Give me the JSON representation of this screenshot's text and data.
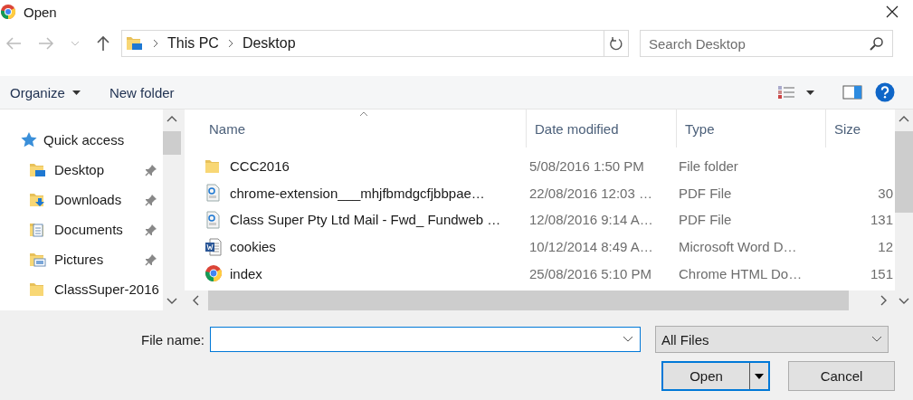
{
  "window": {
    "title": "Open"
  },
  "address": {
    "path": [
      "This PC",
      "Desktop"
    ]
  },
  "search": {
    "placeholder": "Search Desktop"
  },
  "toolbar": {
    "organize": "Organize",
    "new_folder": "New folder"
  },
  "sidebar": {
    "items": [
      {
        "label": "Quick access",
        "kind": "star",
        "pinned": false,
        "indented": false
      },
      {
        "label": "Desktop",
        "kind": "desktop",
        "pinned": true,
        "indented": true
      },
      {
        "label": "Downloads",
        "kind": "downloads",
        "pinned": true,
        "indented": true
      },
      {
        "label": "Documents",
        "kind": "documents",
        "pinned": true,
        "indented": true
      },
      {
        "label": "Pictures",
        "kind": "pictures",
        "pinned": true,
        "indented": true
      },
      {
        "label": "ClassSuper-2016",
        "kind": "folder",
        "pinned": false,
        "indented": true
      }
    ]
  },
  "table": {
    "columns": [
      {
        "label": "Name",
        "sorted": true
      },
      {
        "label": "Date modified",
        "sorted": false
      },
      {
        "label": "Type",
        "sorted": false
      },
      {
        "label": "Size",
        "sorted": false
      }
    ],
    "rows": [
      {
        "kind": "folder",
        "name": "CCC2016",
        "date": "5/08/2016 1:50 PM",
        "type": "File folder"
      },
      {
        "kind": "pdf",
        "name": "chrome-extension___mhjfbmdgcfjbbpae…",
        "date": "22/08/2016 12:03 …",
        "type": "PDF File",
        "size": "30"
      },
      {
        "kind": "pdf",
        "name": "Class Super Pty Ltd Mail - Fwd_ Fundweb …",
        "date": "12/08/2016 9:14 A…",
        "type": "PDF File",
        "size": "131"
      },
      {
        "kind": "word",
        "name": "cookies",
        "date": "10/12/2014 8:49 A…",
        "type": "Microsoft Word D…",
        "size": "12"
      },
      {
        "kind": "chrome",
        "name": "index",
        "date": "25/08/2016 5:10 PM",
        "type": "Chrome HTML Do…",
        "size": "151"
      }
    ]
  },
  "file_name": {
    "label": "File name:"
  },
  "file_type": {
    "value": "All Files"
  },
  "buttons": {
    "open": "Open",
    "cancel": "Cancel"
  }
}
